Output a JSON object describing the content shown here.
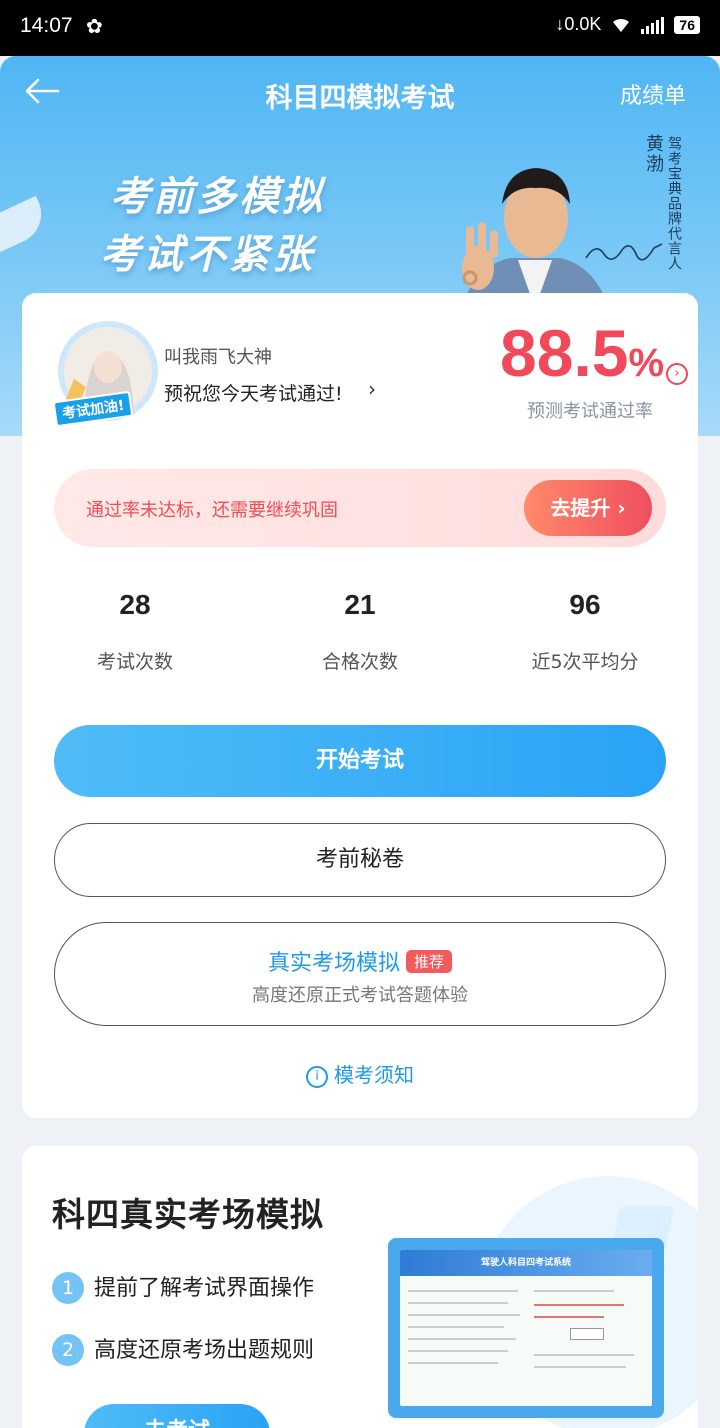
{
  "status_bar": {
    "time": "14:07",
    "network_speed": "↓0.0K",
    "battery": "76"
  },
  "nav": {
    "title": "科目四模拟考试",
    "right_label": "成绩单"
  },
  "banner": {
    "slogan_line1": "考前多模拟",
    "slogan_line2": "考试不紧张",
    "ambassador_name": "黄渤",
    "ambassador_title": "驾考宝典品牌代言人"
  },
  "profile": {
    "avatar_badge": "考试加油!",
    "username": "叫我雨飞大神",
    "wish": "预祝您今天考试通过!"
  },
  "prediction": {
    "rate_value": "88.5",
    "rate_unit": "%",
    "label": "预测考试通过率"
  },
  "warning": {
    "text": "通过率未达标，还需要继续巩固",
    "button_label": "去提升"
  },
  "stats": [
    {
      "value": "28",
      "label": "考试次数"
    },
    {
      "value": "21",
      "label": "合格次数"
    },
    {
      "value": "96",
      "label": "近5次平均分"
    }
  ],
  "actions": {
    "start_exam": "开始考试",
    "secret_paper": "考前秘卷",
    "real_sim_title": "真实考场模拟",
    "real_sim_badge": "推荐",
    "real_sim_subtitle": "高度还原正式考试答题体验",
    "notice": "模考须知"
  },
  "real_card": {
    "title": "科四真实考场模拟",
    "points": [
      {
        "index": "1",
        "text": "提前了解考试界面操作"
      },
      {
        "index": "2",
        "text": "高度还原考场出题规则"
      }
    ],
    "button_label": "去考试",
    "screen_banner": "驾驶人科目四考试系统"
  },
  "colors": {
    "accent_blue": "#2aa3f5",
    "warning_red": "#f1485a",
    "header_blue": "#4fb6f4"
  }
}
